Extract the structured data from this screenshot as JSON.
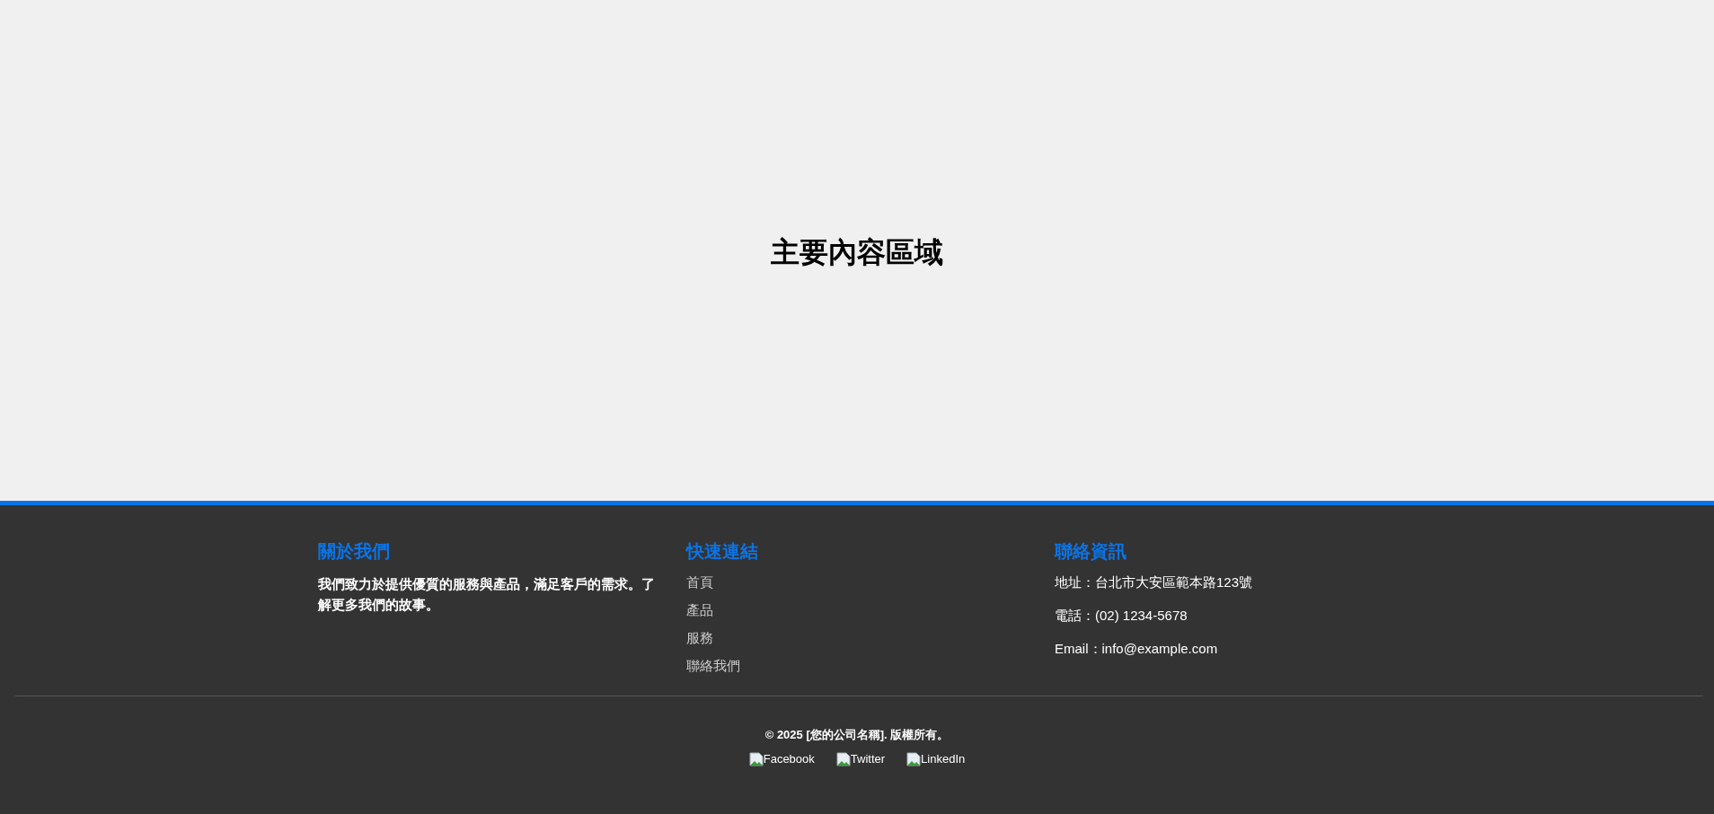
{
  "main": {
    "heading": "主要內容區域"
  },
  "footer": {
    "columns": [
      {
        "kind": "text",
        "title": "關於我們",
        "text": "我們致力於提供優質的服務與產品，滿足客戶的需求。了解更多我們的故事。"
      },
      {
        "kind": "links",
        "title": "快速連結",
        "items": [
          "首頁",
          "產品",
          "服務",
          "聯絡我們"
        ]
      },
      {
        "kind": "lines",
        "title": "聯絡資訊",
        "items": [
          "地址：台北市大安區範本路123號",
          "電話：(02) 1234-5678",
          "Email：info@example.com"
        ]
      }
    ],
    "copyright": "© 2025 [您的公司名稱]. 版權所有。",
    "social": [
      "Facebook",
      "Twitter",
      "LinkedIn"
    ]
  }
}
